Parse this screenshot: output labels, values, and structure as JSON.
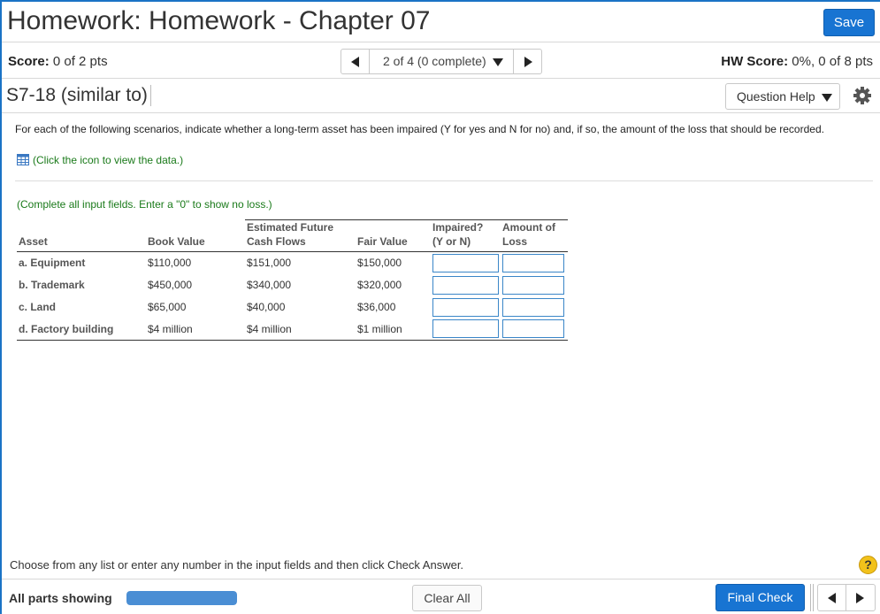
{
  "header": {
    "title": "Homework: Homework - Chapter 07",
    "save_label": "Save"
  },
  "score_bar": {
    "score_label": "Score:",
    "score_value": "0 of 2 pts",
    "nav_label": "2 of 4 (0 complete)",
    "hw_score_label": "HW Score:",
    "hw_score_value": "0%, 0 of 8 pts"
  },
  "question": {
    "id": "S7-18 (similar to)",
    "help_label": "Question Help"
  },
  "content": {
    "instructions": "For each of the following scenarios, indicate whether a long-term asset has been impaired (Y for yes and N for no) and, if so, the amount of the loss that should be recorded.",
    "data_link": "(Click the icon to view the data.)",
    "complete_note": "(Complete all input fields. Enter a \"0\" to show no loss.)"
  },
  "table": {
    "headers": {
      "asset": "Asset",
      "book_value": "Book Value",
      "future_line1": "Estimated Future",
      "future_line2": "Cash Flows",
      "fair_value": "Fair Value",
      "impaired_line1": "Impaired?",
      "impaired_line2": "(Y or N)",
      "loss_line1": "Amount of",
      "loss_line2": "Loss"
    },
    "rows": [
      {
        "asset": "a.  Equipment",
        "book_value": "$110,000",
        "future_cash": "$151,000",
        "fair_value": "$150,000"
      },
      {
        "asset": "b.  Trademark",
        "book_value": "$450,000",
        "future_cash": "$340,000",
        "fair_value": "$320,000"
      },
      {
        "asset": "c.  Land",
        "book_value": "$65,000",
        "future_cash": "$40,000",
        "fair_value": "$36,000"
      },
      {
        "asset": "d.  Factory building",
        "book_value": "$4 million",
        "future_cash": "$4 million",
        "fair_value": "$1 million"
      }
    ]
  },
  "bottom": {
    "choose_note": "Choose from any list or enter any number in the input fields and then click Check Answer.",
    "help_symbol": "?"
  },
  "footer": {
    "all_parts_label": "All parts showing",
    "progress_fraction": 1.0,
    "clear_label": "Clear All",
    "final_label": "Final Check"
  },
  "colors": {
    "accent_blue": "#1874d2",
    "link_green": "#1a7a1a",
    "input_border": "#3a86c8",
    "help_yellow": "#f2c21b"
  },
  "icons": [
    "chevron-left-icon",
    "chevron-right-icon",
    "caret-down-icon",
    "gear-icon",
    "grid-icon",
    "question-icon"
  ]
}
